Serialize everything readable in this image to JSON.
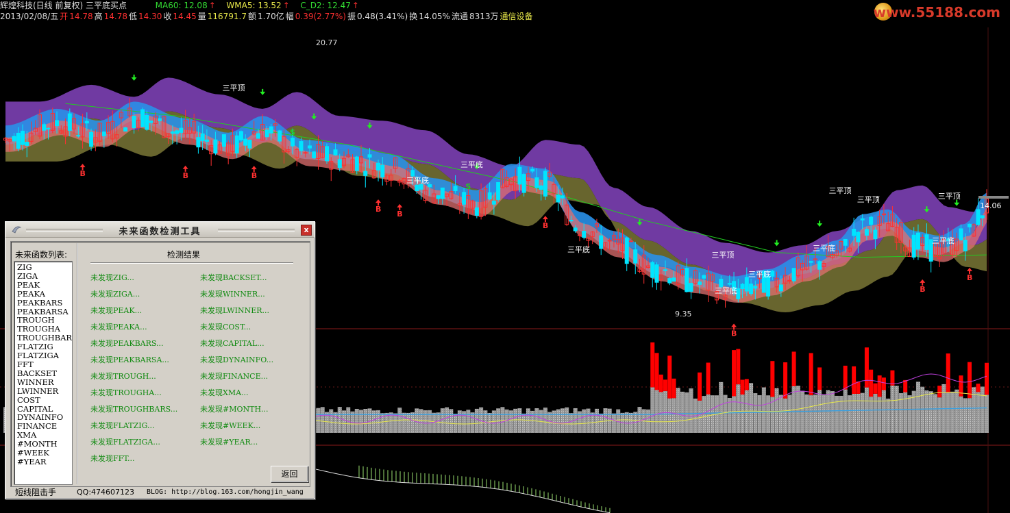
{
  "header": {
    "line1": {
      "title": "辉煌科技(日线 前复权) 三平底买点",
      "ma60": "MA60: 12.08",
      "wma5": "WMA5: 13.52",
      "cd2": "C_D2: 12.47"
    },
    "line2": {
      "date": "2013/02/08/五",
      "open_label": "开",
      "open": "14.78",
      "high_label": "高",
      "high": "14.78",
      "low_label": "低",
      "low": "14.30",
      "close_label": "收",
      "close": "14.45",
      "vol_label": "量",
      "vol": "116791.7",
      "amt_label": "额",
      "amt": "1.70亿",
      "chg_label": "幅",
      "chg": "0.39(2.77%)",
      "amp_label": "振",
      "amp": "0.48(3.41%)",
      "turn_label": "换",
      "turn": "14.05%",
      "float_label": "流通",
      "float": "8313万",
      "sector": "通信设备"
    }
  },
  "logo": {
    "text": "www.55188.com"
  },
  "chart_labels": {
    "high_price": "20.77",
    "low_price": "9.35",
    "last_price": "14.06",
    "sanpingding": "三平顶",
    "sanpingdi": "三平底",
    "buy": "B",
    "sell": "S"
  },
  "chart_data": {
    "type": "candlestick",
    "series": [
      {
        "name": "MA60",
        "values": [
          12.08
        ]
      },
      {
        "name": "WMA5",
        "values": [
          13.52
        ]
      },
      {
        "name": "C_D2",
        "values": [
          12.47
        ]
      }
    ],
    "price_high": 20.77,
    "price_low": 9.35,
    "last": 14.06
  },
  "dialog": {
    "title": "未来函数检测工具",
    "list_label": "未来函数列表:",
    "functions": [
      "ZIG",
      "ZIGA",
      "PEAK",
      "PEAKA",
      "PEAKBARS",
      "PEAKBARSA",
      "TROUGH",
      "TROUGHA",
      "TROUGHBARS",
      "FLATZIG",
      "FLATZIGA",
      "FFT",
      "BACKSET",
      "WINNER",
      "LWINNER",
      "COST",
      "CAPITAL",
      "DYNAINFO",
      "FINANCE",
      "XMA",
      "#MONTH",
      "#WEEK",
      "#YEAR"
    ],
    "result_title": "检测结果",
    "results_left": [
      "未发现ZIG...",
      "未发现ZIGA...",
      "未发现PEAK...",
      "未发现PEAKA...",
      "未发现PEAKBARS...",
      "未发现PEAKBARSA...",
      "未发现TROUGH...",
      "未发现TROUGHA...",
      "未发现TROUGHBARS...",
      "未发现FLATZIG...",
      "未发现FLATZIGA...",
      "未发现FFT..."
    ],
    "results_right": [
      "未发现BACKSET...",
      "未发现WINNER...",
      "未发现LWINNER...",
      "未发现COST...",
      "未发现CAPITAL...",
      "未发现DYNAINFO...",
      "未发现FINANCE...",
      "未发现XMA...",
      "未发现#MONTH...",
      "未发现#WEEK...",
      "未发现#YEAR..."
    ],
    "back_label": "返回",
    "status_author": "短线阻击手",
    "status_qq": "QQ:474607123",
    "status_blog": "BLOG: http://blog.163.com/hongjin_wang",
    "close_label": "x"
  },
  "colors": {
    "up": "#ff3030",
    "down": "#00e5ff",
    "purple_band": "#7a3fb0",
    "olive_band": "#6e6a30",
    "blue_band": "#2a90e8",
    "salmon_band": "#e07070",
    "ma_green": "#22cc22",
    "volume_red": "#ff0000",
    "volume_gray": "#a0a0a0"
  }
}
